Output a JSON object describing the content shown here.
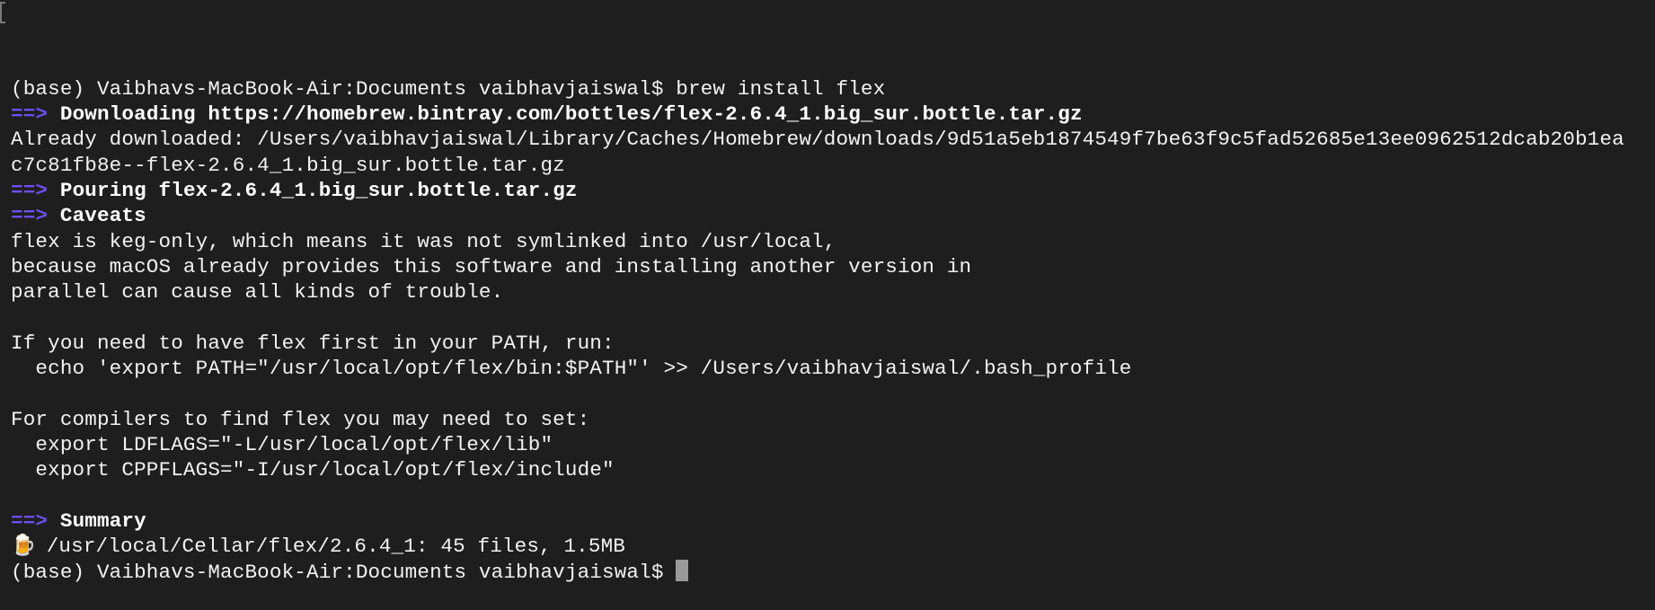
{
  "terminal": {
    "lines": [
      {
        "type": "prompt",
        "text": "(base) Vaibhavs-MacBook-Air:Documents vaibhavjaiswal$ brew install flex"
      },
      {
        "type": "header",
        "arrow": "==>",
        "text": "Downloading https://homebrew.bintray.com/bottles/flex-2.6.4_1.big_sur.bottle.tar.gz"
      },
      {
        "type": "plain",
        "text": "Already downloaded: /Users/vaibhavjaiswal/Library/Caches/Homebrew/downloads/9d51a5eb1874549f7be63f9c5fad52685e13ee0962512dcab20b1ea"
      },
      {
        "type": "plain",
        "text": "c7c81fb8e--flex-2.6.4_1.big_sur.bottle.tar.gz"
      },
      {
        "type": "header",
        "arrow": "==>",
        "text": "Pouring flex-2.6.4_1.big_sur.bottle.tar.gz"
      },
      {
        "type": "header",
        "arrow": "==>",
        "text": "Caveats"
      },
      {
        "type": "plain",
        "text": "flex is keg-only, which means it was not symlinked into /usr/local,"
      },
      {
        "type": "plain",
        "text": "because macOS already provides this software and installing another version in"
      },
      {
        "type": "plain",
        "text": "parallel can cause all kinds of trouble."
      },
      {
        "type": "plain",
        "text": ""
      },
      {
        "type": "plain",
        "text": "If you need to have flex first in your PATH, run:"
      },
      {
        "type": "plain",
        "text": "  echo 'export PATH=\"/usr/local/opt/flex/bin:$PATH\"' >> /Users/vaibhavjaiswal/.bash_profile"
      },
      {
        "type": "plain",
        "text": ""
      },
      {
        "type": "plain",
        "text": "For compilers to find flex you may need to set:"
      },
      {
        "type": "plain",
        "text": "  export LDFLAGS=\"-L/usr/local/opt/flex/lib\""
      },
      {
        "type": "plain",
        "text": "  export CPPFLAGS=\"-I/usr/local/opt/flex/include\""
      },
      {
        "type": "plain",
        "text": ""
      },
      {
        "type": "header",
        "arrow": "==>",
        "text": "Summary"
      },
      {
        "type": "beer",
        "icon": "beer-mug-icon",
        "text": " /usr/local/Cellar/flex/2.6.4_1: 45 files, 1.5MB"
      },
      {
        "type": "prompt",
        "text": "(base) Vaibhavs-MacBook-Air:Documents vaibhavjaiswal$ "
      }
    ],
    "colors": {
      "background": "#1e1e1e",
      "text": "#f2f2f2",
      "arrow": "#6b4ff0"
    }
  }
}
